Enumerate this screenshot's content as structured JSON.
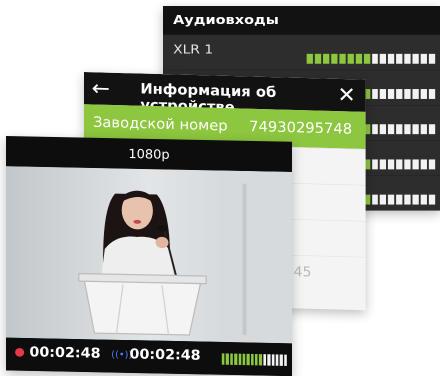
{
  "audio_panel": {
    "title": "Аудиовходы",
    "channel_label": "XLR 1",
    "meter_levels": [
      0.5,
      0.5,
      0.5,
      0.5,
      0.5
    ]
  },
  "info_panel": {
    "title": "Информация об устройстве",
    "back_icon": "arrow-left-icon",
    "close_icon": "close-icon",
    "serial_label": "Заводской номер",
    "serial_value": "74930295748",
    "time_fragment": "58:45"
  },
  "video_panel": {
    "resolution": "1080p",
    "record_time": "00:02:48",
    "stream_time": "00:02:48",
    "stream_icon": "broadcast-icon",
    "meter_level": 0.6
  },
  "colors": {
    "accent_green": "#8dc63f",
    "record_red": "#e63946",
    "stream_blue": "#4f7bff",
    "header_dark": "#121212"
  }
}
